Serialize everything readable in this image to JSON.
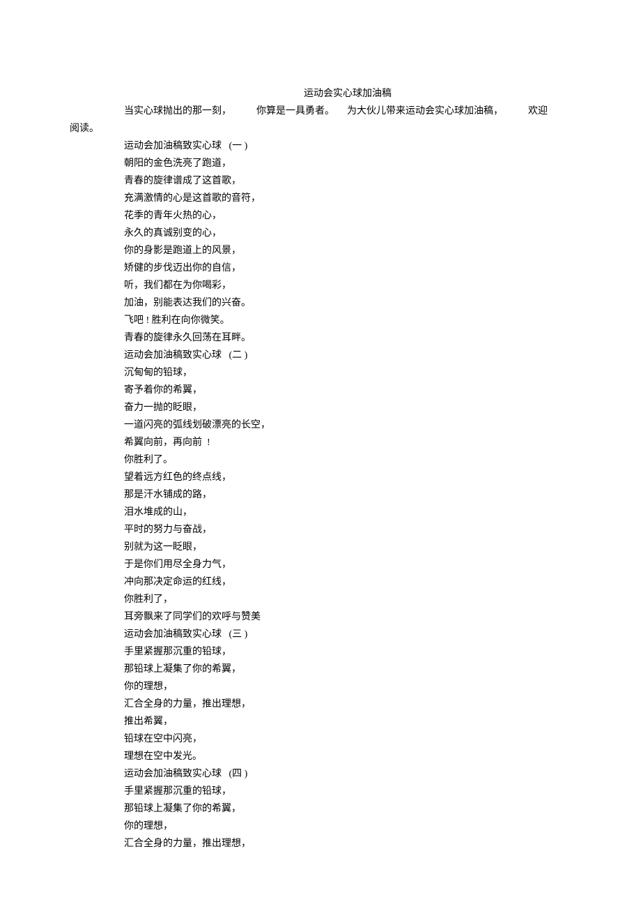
{
  "title": "运动会实心球加油稿",
  "intro_seg1": "当实心球抛出的那一刻，",
  "intro_seg2": "你算是一具勇者。",
  "intro_seg3": "为大伙儿带来运动会实心球加油稿，",
  "intro_seg4": "欢迎",
  "intro_line2": "阅读。",
  "lines": [
    "运动会加油稿致实心球   (一 )",
    "朝阳的金色洗亮了跑道，",
    "青春的旋律谱成了这首歌，",
    "充满激情的心是这首歌的音符，",
    "花季的青年火热的心，",
    "永久的真诚别变的心，",
    "你的身影是跑道上的风景，",
    "矫健的步伐迈出你的自信，",
    "听，我们都在为你喝彩，",
    "加油，别能表达我们的兴奋。",
    "飞吧 ! 胜利在向你微笑。",
    "青春的旋律永久回荡在耳畔。",
    "运动会加油稿致实心球   (二 )",
    "沉甸甸的铅球，",
    "寄予着你的希翼，",
    "奋力一抛的眨眼，",
    "一道闪亮的弧线划破漂亮的长空，",
    "希翼向前，再向前  !",
    "你胜利了。",
    "望着远方红色的终点线，",
    "那是汗水铺成的路，",
    "泪水堆成的山，",
    "平时的努力与奋战，",
    "别就为这一眨眼，",
    "于是你们用尽全身力气，",
    "冲向那决定命运的红线，",
    "你胜利了，",
    "耳旁飘来了同学们的欢呼与赞美",
    "运动会加油稿致实心球   (三 )",
    "手里紧握那沉重的铅球，",
    "那铅球上凝集了你的希翼，",
    "你的理想，",
    "汇合全身的力量，推出理想，",
    "推出希翼，",
    "铅球在空中闪亮，",
    "理想在空中发光。",
    "运动会加油稿致实心球   (四 )",
    "手里紧握那沉重的铅球，",
    "那铅球上凝集了你的希翼，",
    "你的理想，",
    "汇合全身的力量，推出理想，"
  ]
}
